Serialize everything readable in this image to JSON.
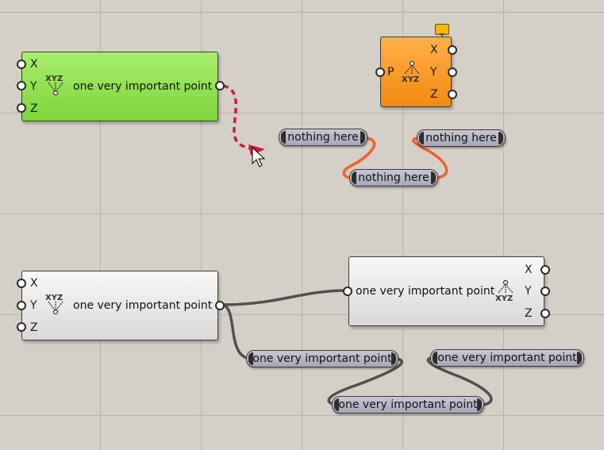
{
  "canvas": {
    "background": "#d4d0c8"
  },
  "components": {
    "green_point": {
      "inputs": [
        "X",
        "Y",
        "Z"
      ],
      "label": "one very important point",
      "icon": "xyz-point-icon",
      "color": "#8fe04a"
    },
    "orange_deconstruct": {
      "input": "P",
      "outputs": [
        "X",
        "Y",
        "Z"
      ],
      "icon": "xyz-point-icon",
      "color": "#f5961e",
      "has_balloon": true
    },
    "grey_point": {
      "inputs": [
        "X",
        "Y",
        "Z"
      ],
      "label": "one very important point",
      "icon": "xyz-point-icon"
    },
    "grey_deconstruct": {
      "label": "one very important point",
      "outputs": [
        "X",
        "Y",
        "Z"
      ],
      "icon": "xyz-point-icon"
    }
  },
  "panels": {
    "top_left": "nothing here",
    "top_right": "nothing here",
    "top_middle": "nothing here",
    "bottom_left": "one very important point",
    "bottom_right": "one very important point",
    "bottom_middle": "one very important point"
  },
  "colors": {
    "wire_orange": "#f0622a",
    "wire_grey": "#505050",
    "wire_drag": "#d01a3a"
  }
}
